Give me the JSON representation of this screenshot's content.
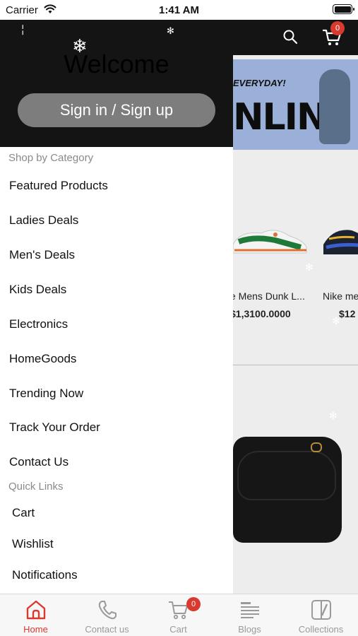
{
  "status_bar": {
    "carrier": "Carrier",
    "time": "1:41 AM"
  },
  "background": {
    "cart_badge": "0",
    "banner_top_text": "EVERYDAY!",
    "banner_big_text": "NLINE",
    "products": [
      {
        "name": "e Mens Dunk L...",
        "price": "$1,3100.0000"
      },
      {
        "name": "Nike me",
        "price": "$12"
      }
    ]
  },
  "drawer": {
    "welcome": "Welcome",
    "signin_label": "Sign in / Sign up",
    "shop_by_category_title": "Shop by Category",
    "categories": [
      "Featured Products",
      "Ladies Deals",
      "Men's Deals",
      "Kids Deals",
      "Electronics",
      "HomeGoods",
      "Trending Now",
      "Track Your Order",
      "Contact Us"
    ],
    "quick_links_title": "Quick Links",
    "quick_links": [
      "Cart",
      "Wishlist",
      "Notifications"
    ]
  },
  "tab_bar": {
    "tabs": [
      {
        "label": "Home",
        "icon": "home-icon",
        "active": true
      },
      {
        "label": "Contact us",
        "icon": "phone-icon"
      },
      {
        "label": "Cart",
        "icon": "cart-icon",
        "badge": "0"
      },
      {
        "label": "Blogs",
        "icon": "blogs-icon"
      },
      {
        "label": "Collections",
        "icon": "collections-icon"
      }
    ]
  },
  "colors": {
    "accent": "#d93a30",
    "drawer_header": "#141414",
    "signin_button": "#7d7d7d"
  }
}
